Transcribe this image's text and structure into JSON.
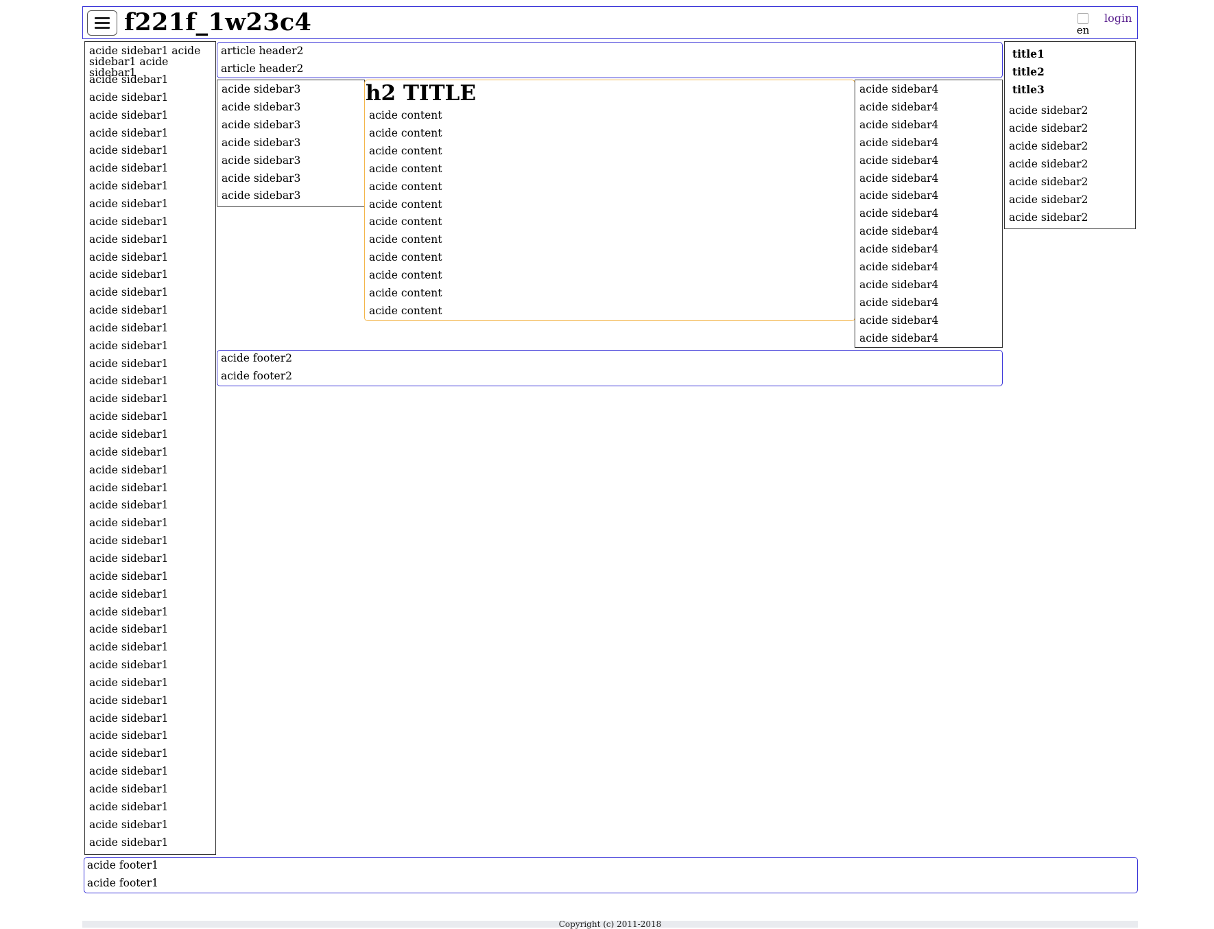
{
  "header": {
    "title": "f221f_1w23c4",
    "menu_icon": "hamburger-menu-icon",
    "lang_alt": "en",
    "login_label": "login",
    "link_color": "#551a8b"
  },
  "sidebar1": {
    "first": "acide sidebar1 acide sidebar1 acide sidebar1",
    "items": [
      "acide sidebar1",
      "acide sidebar1",
      "acide sidebar1",
      "acide sidebar1",
      "acide sidebar1",
      "acide sidebar1",
      "acide sidebar1",
      "acide sidebar1",
      "acide sidebar1",
      "acide sidebar1",
      "acide sidebar1",
      "acide sidebar1",
      "acide sidebar1",
      "acide sidebar1",
      "acide sidebar1",
      "acide sidebar1",
      "acide sidebar1",
      "acide sidebar1",
      "acide sidebar1",
      "acide sidebar1",
      "acide sidebar1",
      "acide sidebar1",
      "acide sidebar1",
      "acide sidebar1",
      "acide sidebar1",
      "acide sidebar1",
      "acide sidebar1",
      "acide sidebar1",
      "acide sidebar1",
      "acide sidebar1",
      "acide sidebar1",
      "acide sidebar1",
      "acide sidebar1",
      "acide sidebar1",
      "acide sidebar1",
      "acide sidebar1",
      "acide sidebar1",
      "acide sidebar1",
      "acide sidebar1",
      "acide sidebar1",
      "acide sidebar1",
      "acide sidebar1",
      "acide sidebar1",
      "acide sidebar1"
    ]
  },
  "article_header": {
    "items": [
      "article header2",
      "article header2"
    ]
  },
  "sidebar2": {
    "titles": [
      "title1",
      "title2",
      "title3"
    ],
    "items": [
      "acide sidebar2",
      "acide sidebar2",
      "acide sidebar2",
      "acide sidebar2",
      "acide sidebar2",
      "acide sidebar2",
      "acide sidebar2"
    ]
  },
  "sidebar3": {
    "items": [
      "acide sidebar3",
      "acide sidebar3",
      "acide sidebar3",
      "acide sidebar3",
      "acide sidebar3",
      "acide sidebar3",
      "acide sidebar3"
    ]
  },
  "content": {
    "title": "h2 TITLE",
    "items": [
      "acide content",
      "acide content",
      "acide content",
      "acide content",
      "acide content",
      "acide content",
      "acide content",
      "acide content",
      "acide content",
      "acide content",
      "acide content",
      "acide content"
    ],
    "border_color": "#f3b54a"
  },
  "sidebar4": {
    "items": [
      "acide sidebar4",
      "acide sidebar4",
      "acide sidebar4",
      "acide sidebar4",
      "acide sidebar4",
      "acide sidebar4",
      "acide sidebar4",
      "acide sidebar4",
      "acide sidebar4",
      "acide sidebar4",
      "acide sidebar4",
      "acide sidebar4",
      "acide sidebar4",
      "acide sidebar4",
      "acide sidebar4"
    ]
  },
  "footer2": {
    "items": [
      "acide footer2",
      "acide footer2"
    ]
  },
  "footer1": {
    "items": [
      "acide footer1",
      "acide footer1"
    ]
  },
  "copyright": "Copyright (c) 2011-2018",
  "accent_border_color": "#3b36d8"
}
